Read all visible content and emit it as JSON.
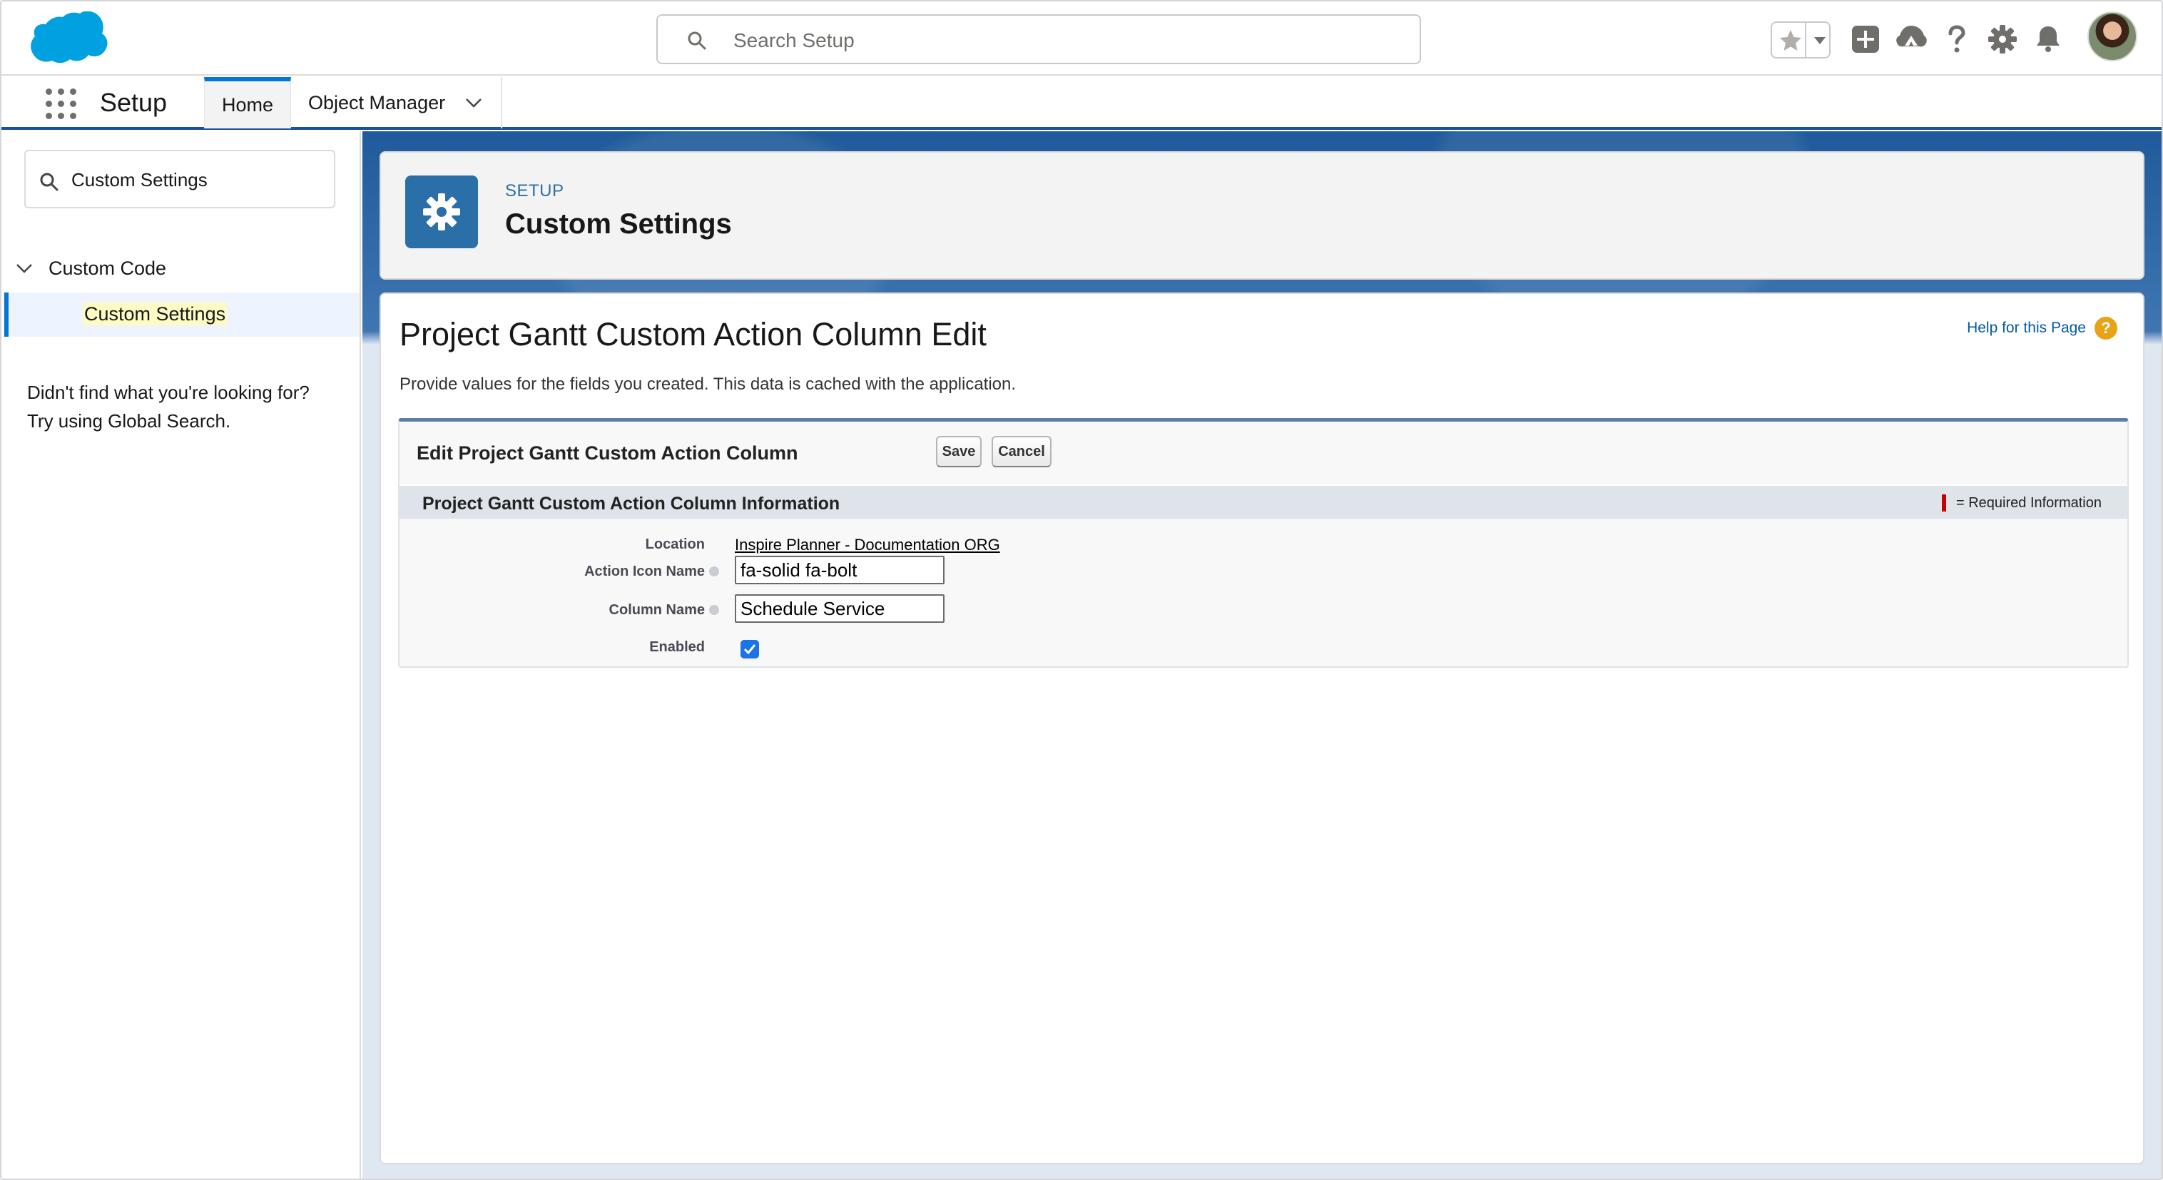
{
  "header": {
    "search_placeholder": "Search Setup",
    "icons": [
      "salesforce-cloud-logo",
      "search-icon",
      "star-icon",
      "chevron-down-icon",
      "plus-icon",
      "trailhead-icon",
      "question-icon",
      "gear-icon",
      "bell-icon",
      "avatar"
    ],
    "brand_color": "#00a1e0"
  },
  "nav": {
    "app_name": "Setup",
    "tabs": [
      {
        "label": "Home"
      },
      {
        "label": "Object Manager"
      }
    ]
  },
  "sidebar": {
    "quick_find_value": "Custom Settings",
    "tree_parent": "Custom Code",
    "tree_child": "Custom Settings",
    "no_find_line1": "Didn't find what you're looking for?",
    "no_find_line2": "Try using Global Search."
  },
  "setup_header": {
    "eyebrow": "SETUP",
    "title": "Custom Settings"
  },
  "page": {
    "title": "Project Gantt Custom Action Column Edit",
    "help_link": "Help for this Page",
    "help_icon": "?",
    "description": "Provide values for the fields you created. This data is cached with the application.",
    "block_title": "Edit Project Gantt Custom Action Column",
    "save_label": "Save",
    "cancel_label": "Cancel",
    "section_title": "Project Gantt Custom Action Column Information",
    "required_info": "= Required Information",
    "fields": {
      "location_label": "Location",
      "location_value": "Inspire Planner - Documentation ORG",
      "action_icon_label": "Action Icon Name",
      "action_icon_value": "fa-solid fa-bolt",
      "column_name_label": "Column Name",
      "column_name_value": "Schedule Service",
      "enabled_label": "Enabled",
      "enabled_checked": true
    }
  },
  "colors": {
    "accent": "#0176d3",
    "setup_icon_bg": "#2a6fa8",
    "link": "#015ba7",
    "required": "#cc0000"
  }
}
